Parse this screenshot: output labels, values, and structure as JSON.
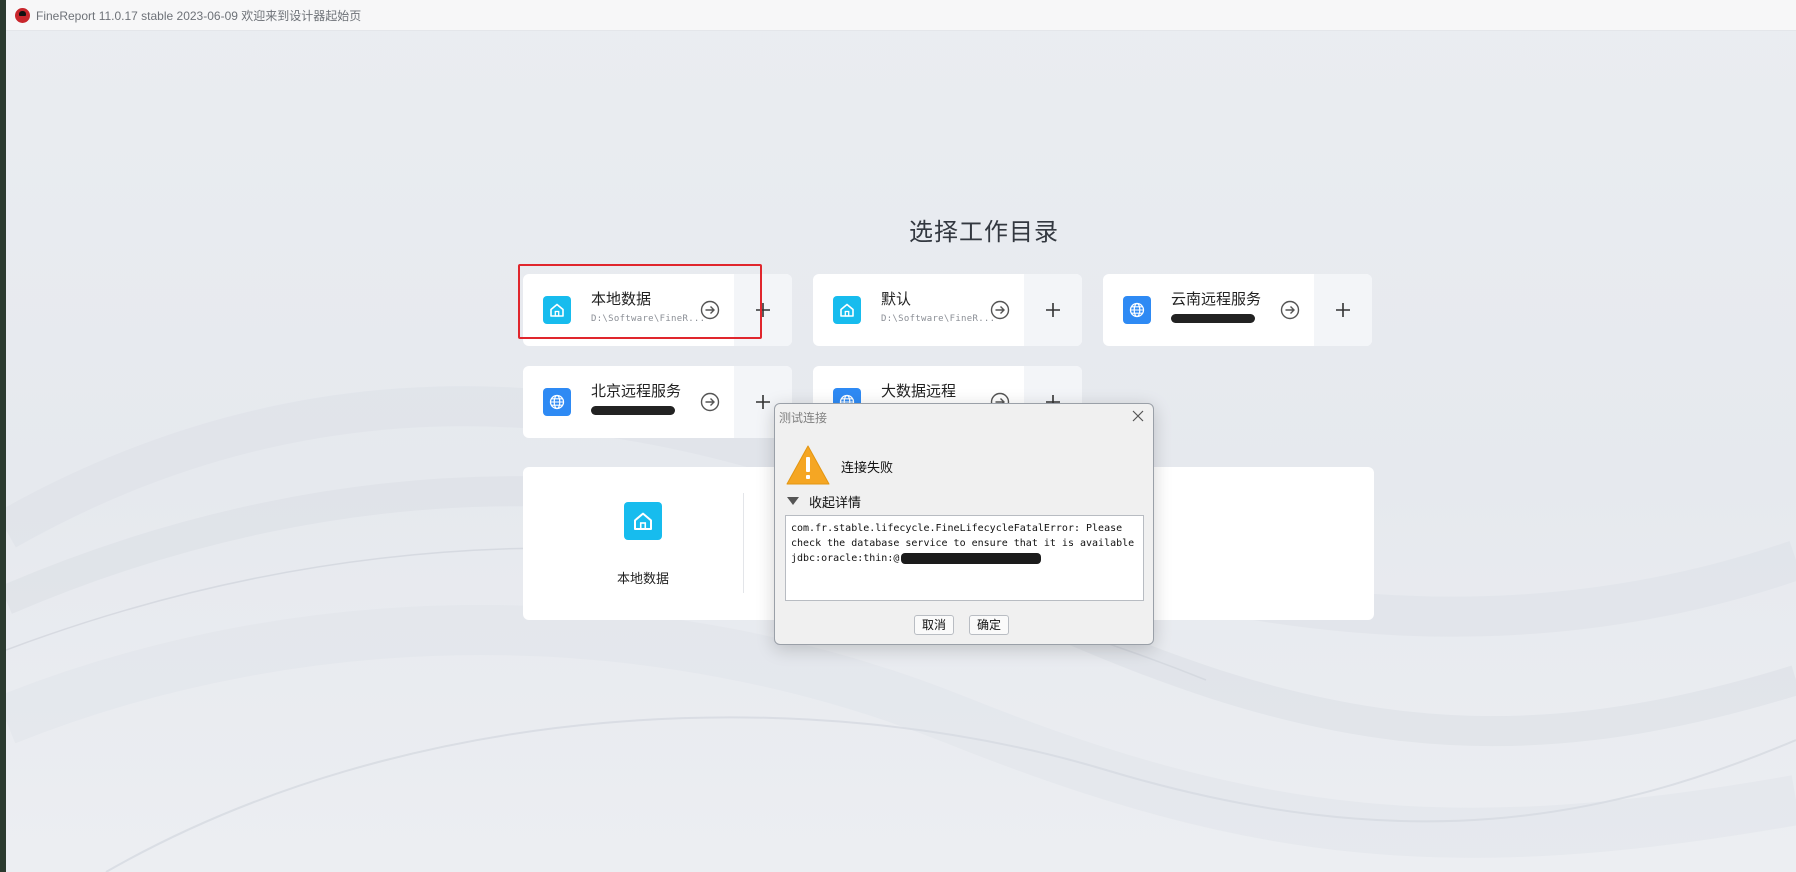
{
  "window": {
    "title": "FineReport 11.0.17 stable 2023-06-09 欢迎来到设计器起始页"
  },
  "main": {
    "heading": "选择工作目录",
    "workspaces": [
      {
        "name": "本地数据",
        "path": "D:\\Software\\FineR...",
        "icon": "home-icon",
        "highlighted": true
      },
      {
        "name": "默认",
        "path": "D:\\Software\\FineR...",
        "icon": "home-icon",
        "highlighted": false
      },
      {
        "name": "云南远程服务",
        "path": "",
        "icon": "globe-icon",
        "highlighted": false
      },
      {
        "name": "北京远程服务",
        "path": "",
        "icon": "globe-icon",
        "highlighted": false
      },
      {
        "name": "大数据远程",
        "path": "",
        "icon": "globe-icon",
        "highlighted": false
      }
    ],
    "bottom_panel": {
      "label": "本地数据"
    }
  },
  "dialog": {
    "title": "测试连接",
    "message": "连接失败",
    "details_toggle": "收起详情",
    "details_lines": [
      "com.fr.stable.lifecycle.FineLifecycleFatalError: Please",
      "check the database service to ensure that it is available",
      "jdbc:oracle:thin:@"
    ],
    "cancel_label": "取消",
    "ok_label": "确定"
  },
  "colors": {
    "highlight_border": "#e0262d",
    "home_icon_bg": "#17bcee",
    "globe_icon_bg": "#2e8af4",
    "warning": "#f5a623"
  }
}
